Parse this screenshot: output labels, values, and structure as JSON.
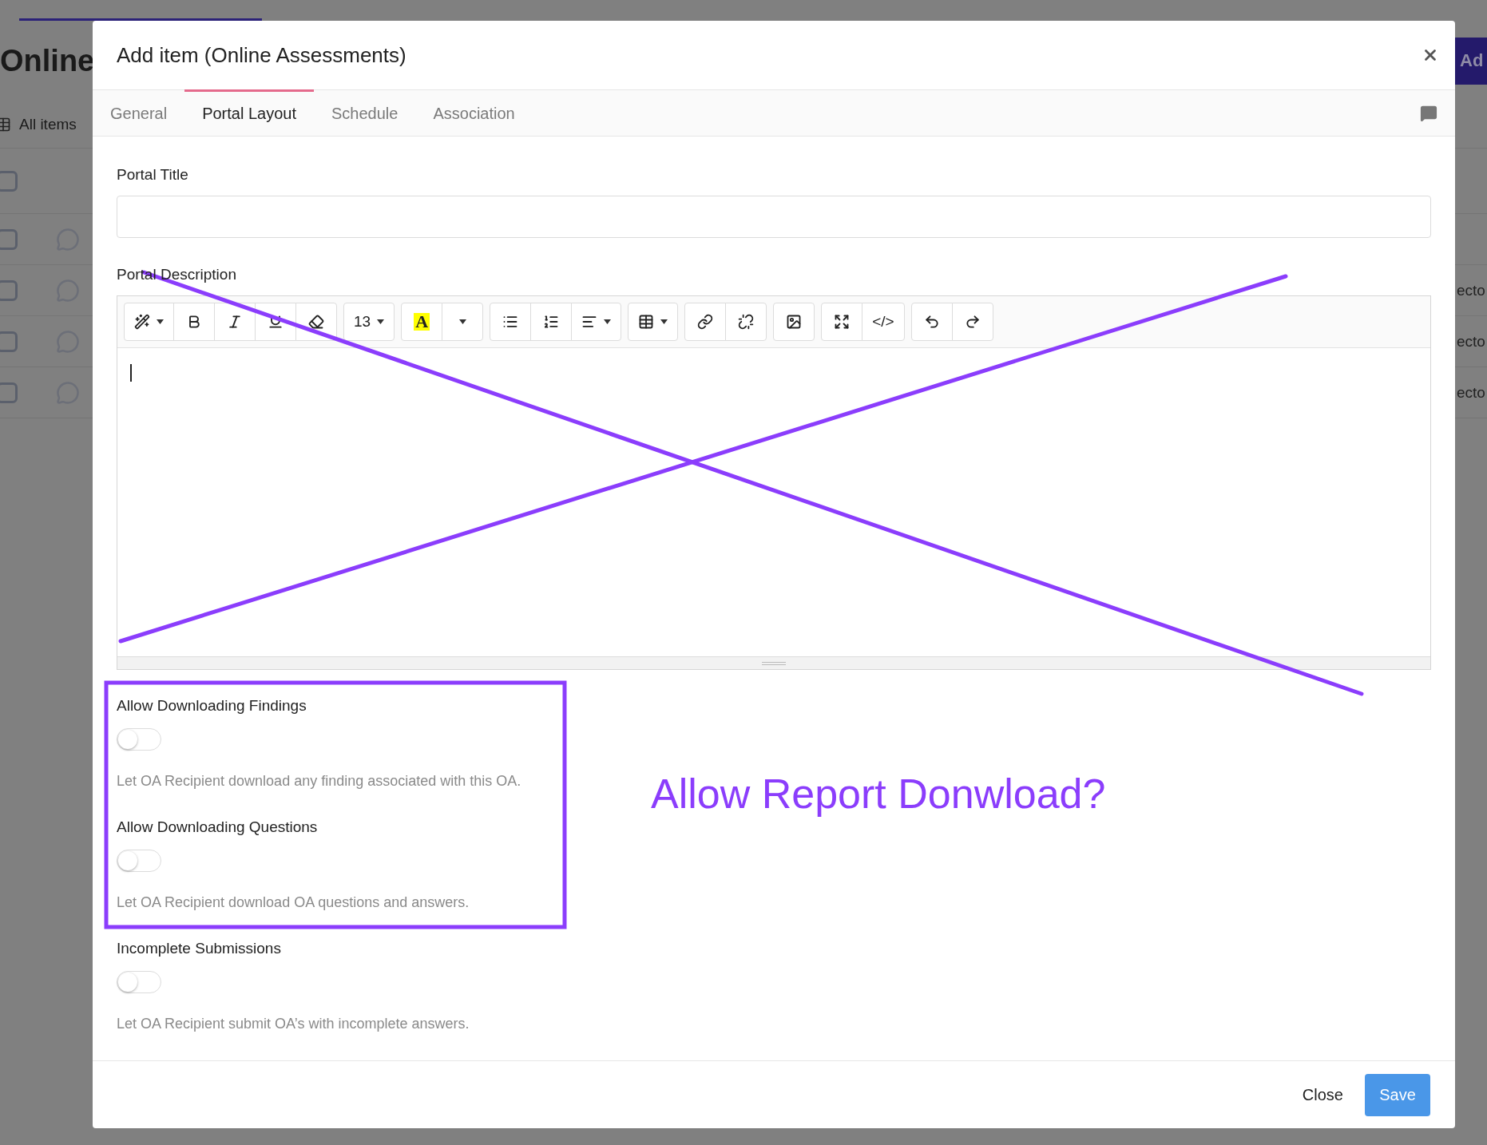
{
  "background": {
    "page_title": "Online",
    "add_button": "Ad",
    "view_label": "All items",
    "header_row": {
      "checked": false
    },
    "rows": [
      {
        "checked": false
      },
      {
        "checked": false,
        "text": "ecto"
      },
      {
        "checked": false,
        "text": "ecto"
      },
      {
        "checked": false,
        "text": "ecto"
      }
    ]
  },
  "dialog": {
    "title": "Add item (Online Assessments)",
    "tabs": [
      {
        "label": "General",
        "selected": false
      },
      {
        "label": "Portal Layout",
        "selected": true
      },
      {
        "label": "Schedule",
        "selected": false
      },
      {
        "label": "Association",
        "selected": false
      }
    ],
    "portal_title": {
      "label": "Portal Title"
    },
    "portal_description": {
      "label": "Portal Description",
      "toolbar": [
        {
          "buttons": [
            {
              "kind": "wand",
              "caret": true
            },
            {
              "kind": "bold"
            },
            {
              "kind": "italic"
            },
            {
              "kind": "underline"
            },
            {
              "kind": "eraser"
            }
          ]
        },
        {
          "buttons": [
            {
              "kind": "font_size",
              "text": "13",
              "caret": true
            }
          ]
        },
        {
          "buttons": [
            {
              "kind": "highlight",
              "text": "A"
            },
            {
              "kind": "more",
              "caret": true
            }
          ]
        },
        {
          "buttons": [
            {
              "kind": "bullets"
            },
            {
              "kind": "numbered"
            },
            {
              "kind": "align",
              "caret": true
            }
          ]
        },
        {
          "buttons": [
            {
              "kind": "table",
              "caret": true
            }
          ]
        },
        {
          "buttons": [
            {
              "kind": "link"
            },
            {
              "kind": "unlink"
            }
          ]
        },
        {
          "buttons": [
            {
              "kind": "image"
            }
          ]
        },
        {
          "buttons": [
            {
              "kind": "fullscreen"
            },
            {
              "kind": "code",
              "text": "</>"
            }
          ]
        },
        {
          "buttons": [
            {
              "kind": "undo"
            },
            {
              "kind": "redo"
            }
          ]
        }
      ]
    },
    "toggles": [
      {
        "label": "Allow Downloading Findings",
        "on": false,
        "help": "Let OA Recipient download any finding associated with this OA."
      },
      {
        "label": "Allow Downloading Questions",
        "on": false,
        "help": "Let OA Recipient download OA questions and answers."
      },
      {
        "label": "Incomplete Submissions",
        "on": false,
        "help": "Let OA Recipient submit OA’s with incomplete answers."
      }
    ],
    "buttons": {
      "close": "Close",
      "save": "Save"
    }
  },
  "annotation": {
    "text": "Allow Report Donwload?"
  }
}
